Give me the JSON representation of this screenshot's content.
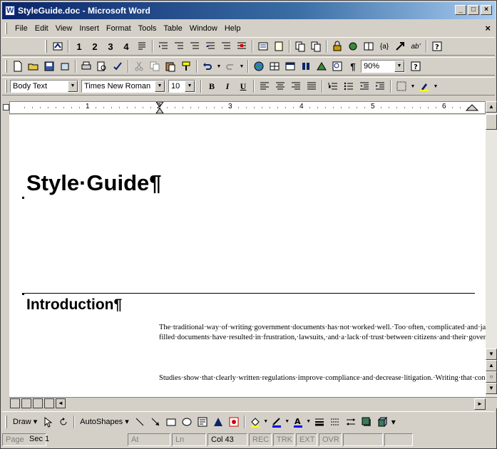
{
  "window": {
    "title": "StyleGuide.doc - Microsoft Word"
  },
  "menu": [
    "File",
    "Edit",
    "View",
    "Insert",
    "Format",
    "Tools",
    "Table",
    "Window",
    "Help"
  ],
  "toolbar3": {
    "style": "Body Text",
    "font": "Times New Roman",
    "size": "10",
    "zoom": "90%"
  },
  "toolbar1": {
    "levels": [
      "1",
      "2",
      "3",
      "4"
    ]
  },
  "ruler": {
    "marks": [
      "1",
      "2",
      "3",
      "4",
      "5",
      "6"
    ]
  },
  "document": {
    "title": "Style·Guide¶",
    "heading": "Introduction¶",
    "para1": "The·traditional·way·of·writing·government·documents·has·not·worked·well.·Too·often,·complicated·and·jargon-filled·documents·have·resulted·in·frustration,·lawsuits,·and·a·lack·of·trust·between·citizens·and·their·government.·To·overcome·this·legacy,·we·have·a·great·responsibility·to·communicate·clearly.·¶",
    "para2": "Studies·show·that·clearly·written·regulations·improve·compliance·and·decrease·litigation.·Writing·that·considers·our·readers'·needs·improves·the·relationship·"
  },
  "drawing": {
    "draw": "Draw",
    "autoshapes": "AutoShapes"
  },
  "status": {
    "page": "Page",
    "sec": "Sec 1",
    "at": "At",
    "ln": "Ln",
    "col": "Col 43",
    "rec": "REC",
    "trk": "TRK",
    "ext": "EXT",
    "ovr": "OVR"
  }
}
